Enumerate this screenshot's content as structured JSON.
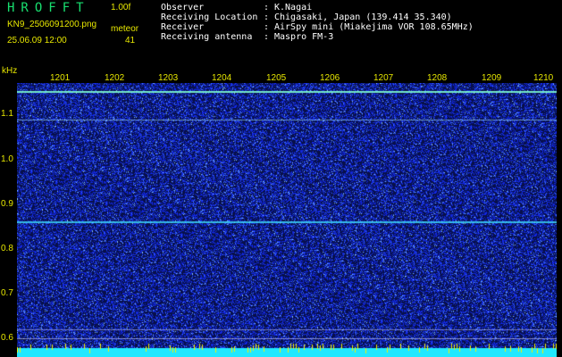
{
  "header": {
    "app_title": "HROFFT",
    "version": "1.00f",
    "filename": "KN9_2506091200.png",
    "mode": "meteor",
    "datetime": "25.06.09 12:00",
    "count": "41"
  },
  "info": [
    {
      "label": "Observer",
      "value": "K.Nagai"
    },
    {
      "label": "Receiving Location",
      "value": "Chigasaki, Japan (139.414 35.340)"
    },
    {
      "label": "Receiver",
      "value": "AirSpy mini (Miakejima VOR 108.65MHz)"
    },
    {
      "label": "Receiving antenna",
      "value": "Maspro FM-3"
    }
  ],
  "plot": {
    "y_unit": "kHz",
    "y_ticks": [
      "1.1",
      "1.0",
      "0.9",
      "0.8",
      "0.7",
      "0.6"
    ],
    "x_ticks": [
      "1201",
      "1202",
      "1203",
      "1204",
      "1205",
      "1206",
      "1207",
      "1208",
      "1209",
      "1210"
    ],
    "colors": {
      "background": "#08104a",
      "noise": "#1a3cff",
      "line": "#40e0ff",
      "axis_text": "#e6e600"
    }
  }
}
